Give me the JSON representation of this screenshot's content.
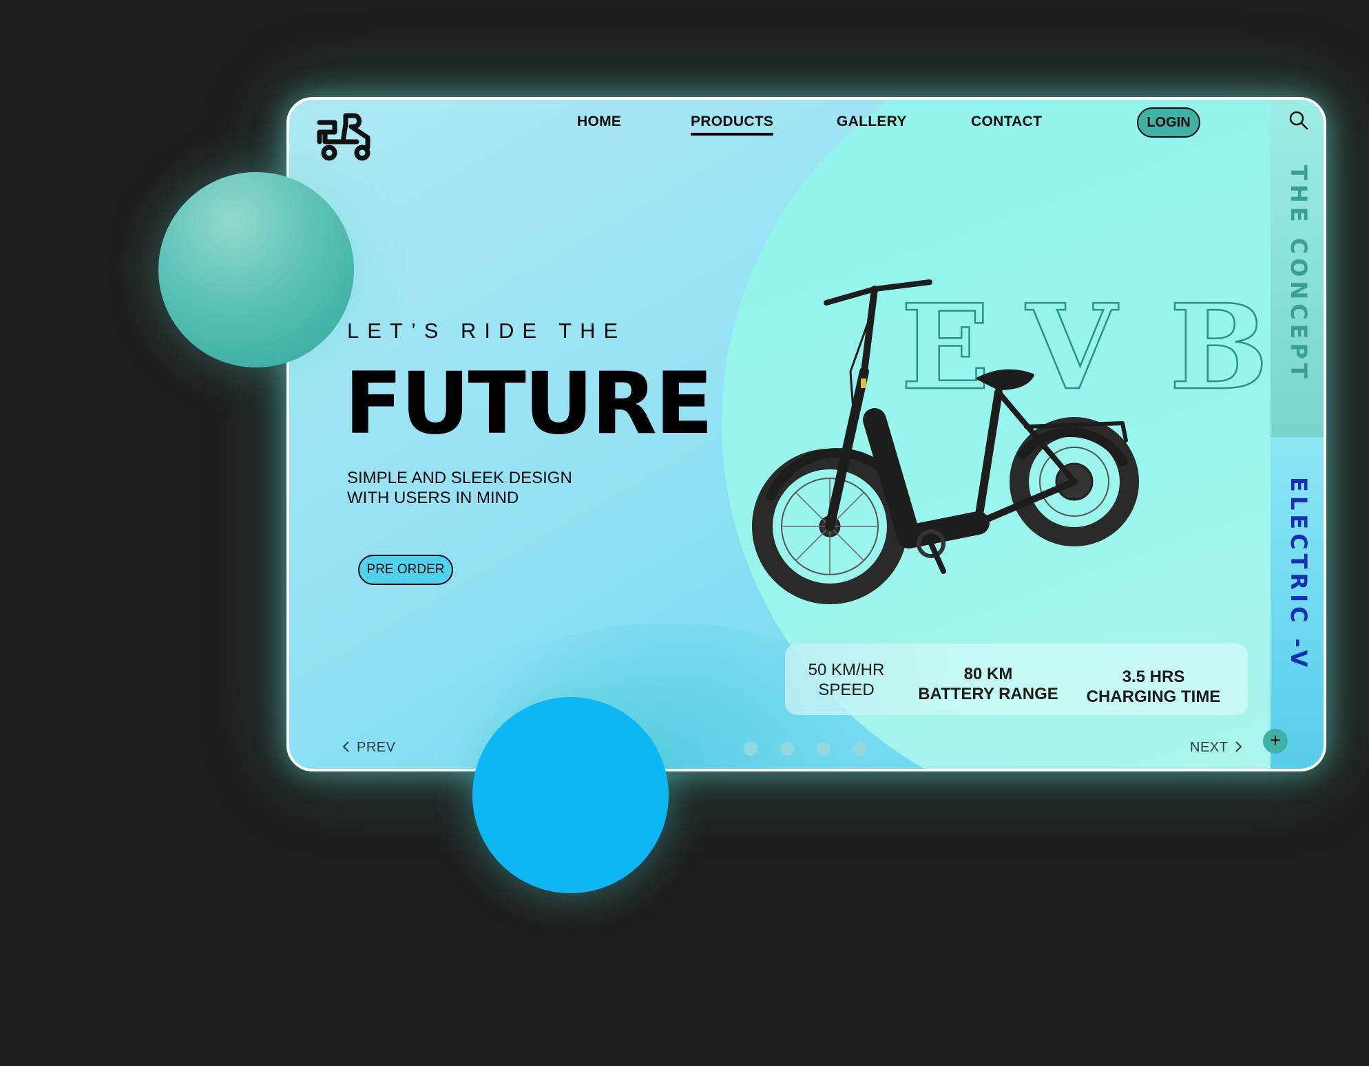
{
  "nav": {
    "home": "HOME",
    "products": "PRODUCTS",
    "gallery": "GALLERY",
    "contact": "CONTACT",
    "login": "LOGIN"
  },
  "side": {
    "top_label": "THE CONCEPT",
    "bottom_label": "ELECTRIC -V"
  },
  "hero": {
    "kicker": "LET’S RIDE THE",
    "title": "FUTURE",
    "tagline_line1": "SIMPLE AND SLEEK DESIGN",
    "tagline_line2": "WITH USERS IN MIND",
    "cta": "PRE ORDER",
    "outline_letters": [
      "E",
      "V",
      "B"
    ]
  },
  "stats": [
    {
      "value": "50 KM/HR",
      "label": "SPEED"
    },
    {
      "value": "80 KM",
      "label": "BATTERY RANGE"
    },
    {
      "value": "3.5 HRS",
      "label": "CHARGING TIME"
    }
  ],
  "pager": {
    "prev": "PREV",
    "next": "NEXT",
    "slides": 4
  },
  "colors": {
    "background": "#1e1f1f",
    "accent_teal": "#3fb2a8",
    "accent_blue": "#0db7f3",
    "side_text_teal": "#3a9f97",
    "side_text_blue": "#1430b8"
  },
  "icons": {
    "logo": "scooter-logo-icon",
    "search": "search-icon",
    "prev": "chevron-left-icon",
    "next": "chevron-right-icon",
    "plus": "plus-icon"
  }
}
